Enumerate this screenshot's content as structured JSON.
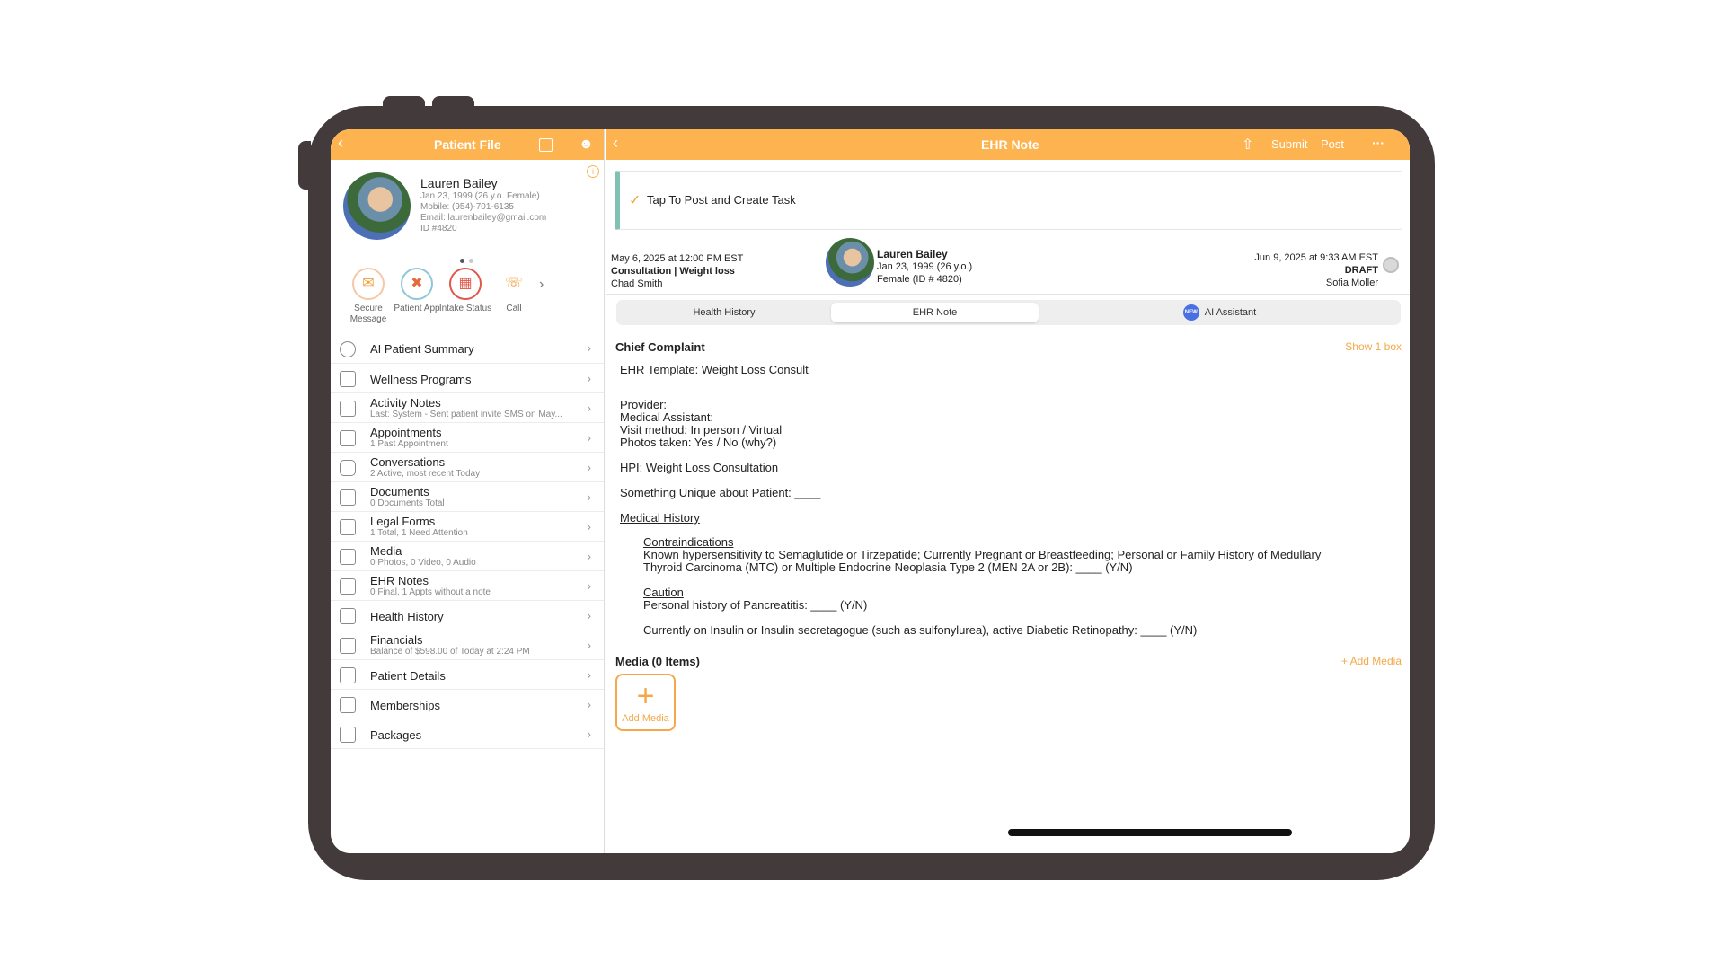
{
  "left_panel": {
    "nav_title": "Patient File",
    "patient": {
      "name": "Lauren Bailey",
      "dob": "Jan 23, 1999 (26 y.o. Female)",
      "mobile": "Mobile: (954)-701-6135",
      "email": "Email: laurenbailey@gmail.com",
      "id": "ID #4820"
    },
    "actions": [
      {
        "label": "Secure Message",
        "icon": "message-icon"
      },
      {
        "label": "Patient App",
        "icon": "patient-app-icon"
      },
      {
        "label": "Intake Status",
        "icon": "intake-icon"
      },
      {
        "label": "Call",
        "icon": "phone-icon"
      }
    ],
    "menu": [
      {
        "label": "AI Patient Summary",
        "sub": "",
        "icon": "ai-summary-icon"
      },
      {
        "label": "Wellness Programs",
        "sub": "",
        "icon": "wellness-icon"
      },
      {
        "label": "Activity Notes",
        "sub": "Last: System - Sent patient invite SMS on May...",
        "icon": "activity-icon"
      },
      {
        "label": "Appointments",
        "sub": "1 Past Appointment",
        "icon": "calendar-icon"
      },
      {
        "label": "Conversations",
        "sub": "2 Active, most recent Today",
        "icon": "chat-icon"
      },
      {
        "label": "Documents",
        "sub": "0 Documents Total",
        "icon": "inbox-icon"
      },
      {
        "label": "Legal Forms",
        "sub": "1 Total, 1 Need Attention",
        "icon": "legal-icon"
      },
      {
        "label": "Media",
        "sub": "0 Photos, 0 Video, 0 Audio",
        "icon": "media-icon"
      },
      {
        "label": "EHR Notes",
        "sub": "0 Final, 1 Appts without a note",
        "icon": "clipboard-icon"
      },
      {
        "label": "Health History",
        "sub": "",
        "icon": "health-icon"
      },
      {
        "label": "Financials",
        "sub": "Balance of $598.00 of Today at 2:24 PM",
        "icon": "wallet-icon"
      },
      {
        "label": "Patient Details",
        "sub": "",
        "icon": "id-card-icon"
      },
      {
        "label": "Memberships",
        "sub": "",
        "icon": "membership-icon"
      },
      {
        "label": "Packages",
        "sub": "",
        "icon": "package-icon"
      }
    ]
  },
  "right_panel": {
    "nav_title": "EHR Note",
    "submit_label": "Submit",
    "post_label": "Post",
    "more_label": "···",
    "banner_text": "Tap To Post and Create Task",
    "header": {
      "date_left": "May 6, 2025 at 12:00 PM EST",
      "consult": "Consultation | Weight loss",
      "provider": "Chad Smith",
      "patient_name": "Lauren Bailey",
      "patient_dob": "Jan 23, 1999 (26 y.o.)",
      "patient_gender_id": "Female (ID # 4820)",
      "date_right": "Jun 9, 2025 at 9:33 AM EST",
      "status": "DRAFT",
      "author": "Sofia Moller"
    },
    "tabs": [
      "Health History",
      "EHR Note",
      "AI Assistant"
    ],
    "new_badge": "NEW",
    "chief_complaint_label": "Chief Complaint",
    "show_box_label": "Show 1 box",
    "note_lines": {
      "template": "EHR Template: Weight Loss Consult",
      "provider": "Provider:",
      "ma": "Medical Assistant:",
      "visit": " Visit method: In person / Virtual",
      "photos": "Photos taken: Yes / No (why?)",
      "hpi": "HPI: Weight Loss Consultation",
      "unique": "Something Unique about Patient: ____",
      "med_history": "Medical History",
      "contra": "Contraindications",
      "contra_1": "Known hypersensitivity to Semaglutide or Tirzepatide; Currently Pregnant or Breastfeeding; Personal or Family History of Medullary",
      "contra_2": "Thyroid Carcinoma (MTC) or Multiple Endocrine Neoplasia Type 2 (MEN 2A or 2B): ____ (Y/N)",
      "caution": "Caution",
      "caution_1": "Personal history of Pancreatitis: ____ (Y/N)",
      "insulin": "Currently on Insulin or Insulin secretagogue (such as sulfonylurea), active Diabetic Retinopathy: ____ (Y/N)"
    },
    "media_label": "Media (0 Items)",
    "add_media_link": "+ Add Media",
    "add_media_tile": "Add Media"
  },
  "colors": {
    "accent": "#fdb450",
    "device": "#433a3c",
    "banner_bar": "#7fc2b4"
  }
}
